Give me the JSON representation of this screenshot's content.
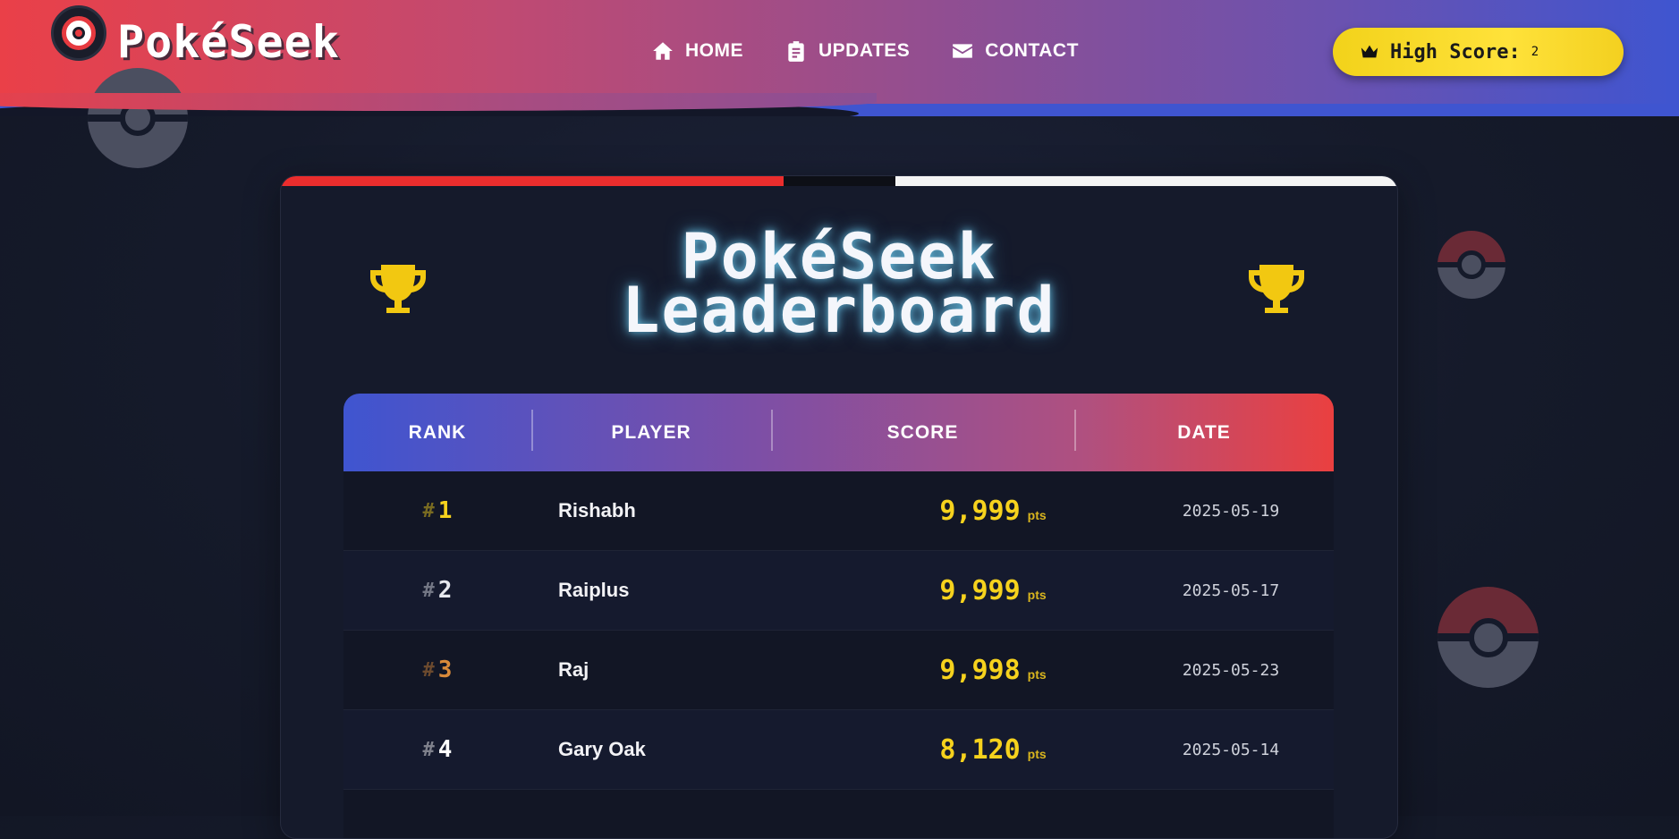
{
  "header": {
    "brand": "PokéSeek",
    "nav": [
      {
        "label": "HOME",
        "icon": "home-icon"
      },
      {
        "label": "UPDATES",
        "icon": "clipboard-icon"
      },
      {
        "label": "CONTACT",
        "icon": "envelope-icon"
      }
    ],
    "high_score": {
      "label": "High Score:",
      "value": "2",
      "icon": "crown-icon"
    }
  },
  "leaderboard": {
    "title_line1": "PokéSeek",
    "title_line2": "Leaderboard",
    "columns": [
      "RANK",
      "PLAYER",
      "SCORE",
      "DATE"
    ],
    "rows": [
      {
        "rank_prefix": "#",
        "rank": "1",
        "player": "Rishabh",
        "score": "9,999",
        "unit": "pts",
        "date": "2025-05-19",
        "rank_color": "#f6d21d"
      },
      {
        "rank_prefix": "#",
        "rank": "2",
        "player": "Raiplus",
        "score": "9,999",
        "unit": "pts",
        "date": "2025-05-17",
        "rank_color": "#e6e8ee"
      },
      {
        "rank_prefix": "#",
        "rank": "3",
        "player": "Raj",
        "score": "9,998",
        "unit": "pts",
        "date": "2025-05-23",
        "rank_color": "#d98a3a"
      },
      {
        "rank_prefix": "#",
        "rank": "4",
        "player": "Gary Oak",
        "score": "8,120",
        "unit": "pts",
        "date": "2025-05-14",
        "rank_color": "#ffffff"
      }
    ]
  },
  "colors": {
    "accent_red": "#ea4040",
    "accent_blue": "#3f55d0",
    "gold": "#f6d21d"
  }
}
